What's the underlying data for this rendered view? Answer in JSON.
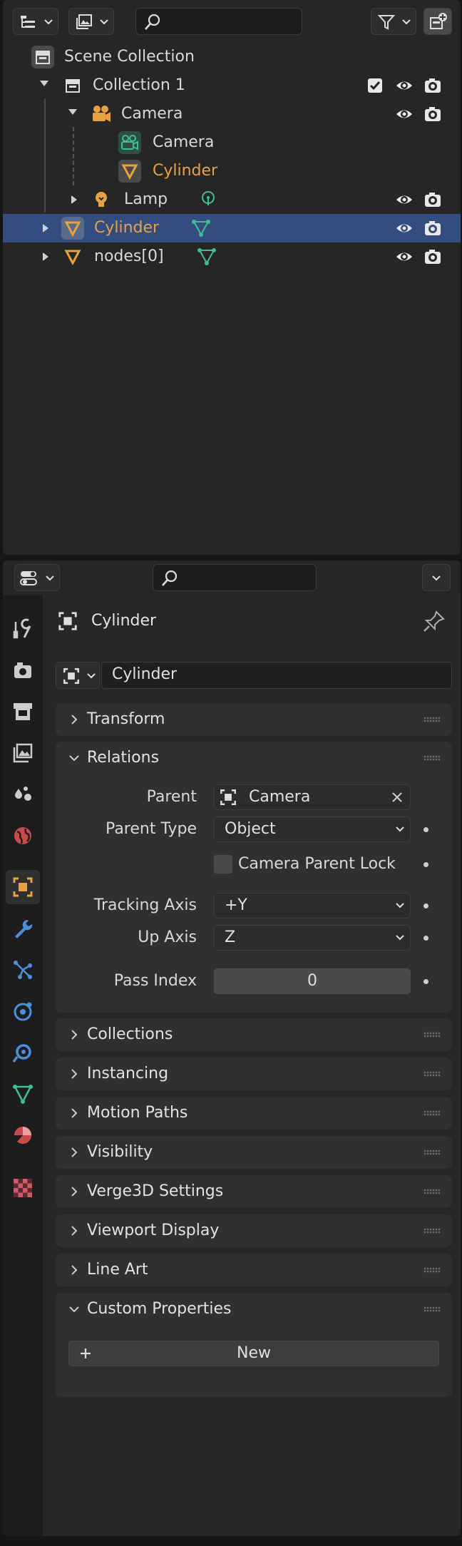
{
  "colors": {
    "selection": "#334d80",
    "object_orange": "#e8a040",
    "data_green": "#3fbf8f",
    "panel_bg": "#303030",
    "editor_bg": "#262626"
  },
  "outliner": {
    "header_icons": [
      "outliner-display-mode-icon",
      "view-layer-icon",
      "search-icon",
      "filter-icon",
      "new-collection-icon"
    ],
    "search_placeholder": "",
    "items": {
      "scene_collection": "Scene Collection",
      "collection1": "Collection 1",
      "camera_object": "Camera",
      "camera_data": "Camera",
      "cylinder_child": "Cylinder",
      "lamp": "Lamp",
      "cylinder": "Cylinder",
      "nodes": "nodes[0]"
    }
  },
  "properties": {
    "search_placeholder": "",
    "object_name": "Cylinder",
    "datablock_name": "Cylinder",
    "tabs": [
      "tool",
      "render",
      "output",
      "view-layer",
      "scene",
      "world",
      "object",
      "modifiers",
      "particles",
      "physics",
      "constraints",
      "data",
      "material",
      "texture"
    ],
    "active_tab": "object",
    "panels": {
      "transform": "Transform",
      "relations": "Relations",
      "collections": "Collections",
      "instancing": "Instancing",
      "motion_paths": "Motion Paths",
      "visibility": "Visibility",
      "verge3d": "Verge3D Settings",
      "viewport_display": "Viewport Display",
      "line_art": "Line Art",
      "custom_properties": "Custom Properties"
    },
    "relations": {
      "parent_label": "Parent",
      "parent_value": "Camera",
      "parent_type_label": "Parent Type",
      "parent_type_value": "Object",
      "camera_parent_lock_label": "Camera Parent Lock",
      "camera_parent_lock_checked": false,
      "tracking_axis_label": "Tracking Axis",
      "tracking_axis_value": "+Y",
      "up_axis_label": "Up Axis",
      "up_axis_value": "Z",
      "pass_index_label": "Pass Index",
      "pass_index_value": "0"
    },
    "custom_properties": {
      "new_label": "New"
    }
  }
}
